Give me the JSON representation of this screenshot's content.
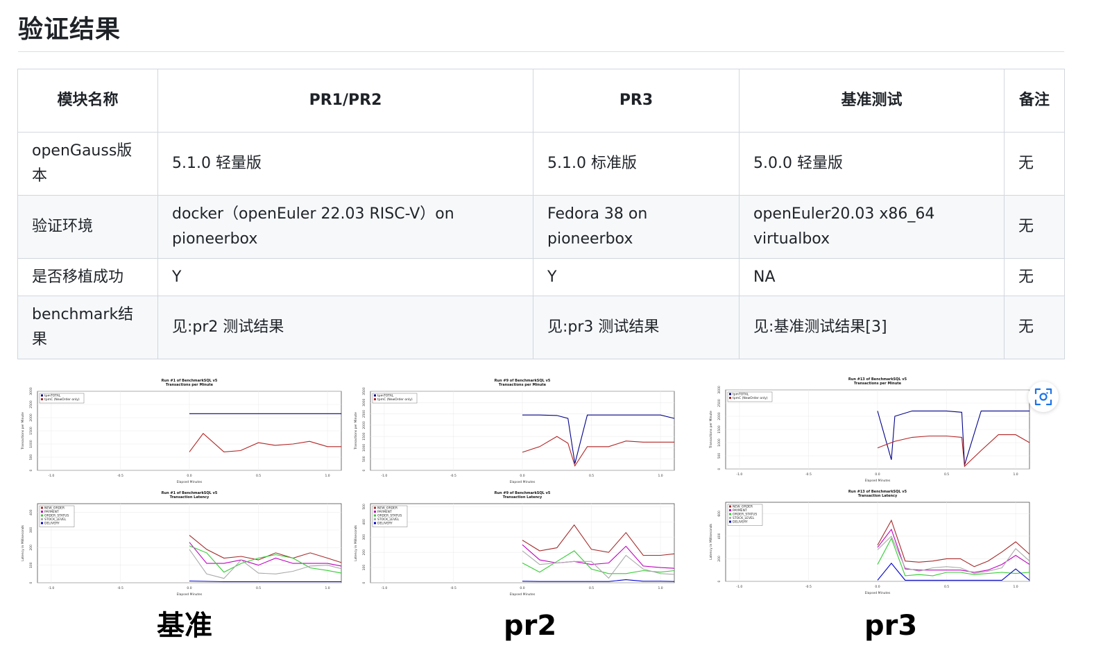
{
  "page": {
    "title": "验证结果"
  },
  "table": {
    "headers": [
      "模块名称",
      "PR1/PR2",
      "PR3",
      "基准测试",
      "备注"
    ],
    "rows": [
      [
        "openGauss版本",
        "5.1.0 轻量版",
        "5.1.0 标准版",
        "5.0.0 轻量版",
        "无"
      ],
      [
        "验证环境",
        "docker（openEuler 22.03 RISC-V）on pioneerbox",
        "Fedora 38 on pioneerbox",
        "openEuler20.03 x86_64 virtualbox",
        "无"
      ],
      [
        "是否移植成功",
        "Y",
        "Y",
        "NA",
        "无"
      ],
      [
        "benchmark结果",
        "见:pr2 测试结果",
        "见:pr3 测试结果",
        "见:基准测试结果[3]",
        "无"
      ]
    ]
  },
  "captions": [
    "基准",
    "pr2",
    "pr3"
  ],
  "icons": {
    "scan": "scan-image-icon"
  },
  "colors": {
    "tpmTOTAL": "#00008b",
    "tpmC": "#b22222",
    "new_order": "#a52a2a",
    "payment": "#c000c0",
    "order_status": "#32cd32",
    "stock_level": "#a9a9a9",
    "delivery": "#0000cd"
  },
  "chart_data": [
    {
      "type": "line",
      "title": "Run #1 of BenchmarkSQL v5",
      "subtitle": "Transactions per Minute",
      "xlabel": "Elapsed Minutes",
      "ylabel": "Transactions per Minute",
      "xlim": [
        -1.1,
        1.1
      ],
      "ylim": [
        0,
        3000
      ],
      "x_ticks": [
        "-1.0",
        "-0.5",
        "0.0",
        "0.5",
        "1.0"
      ],
      "y_ticks": [
        "0",
        "500",
        "1000",
        "1500",
        "2000",
        "2500",
        "3000"
      ],
      "legend": "top-left",
      "series": [
        {
          "name": "tpmTOTAL",
          "x": [
            0,
            0.125,
            0.25,
            0.375,
            0.5,
            0.625,
            0.75,
            0.875,
            1.0,
            1.1
          ],
          "y": [
            2150,
            2150,
            2150,
            2150,
            2150,
            2150,
            2150,
            2150,
            2150,
            2150
          ]
        },
        {
          "name": "tpmC (NewOrder only)",
          "x": [
            0,
            0.1,
            0.25,
            0.37,
            0.5,
            0.62,
            0.75,
            0.87,
            1.0,
            1.1
          ],
          "y": [
            700,
            1400,
            700,
            750,
            1050,
            950,
            1000,
            1100,
            900,
            900
          ]
        }
      ]
    },
    {
      "type": "line",
      "title": "Run #1 of BenchmarkSQL v5",
      "subtitle": "Transaction Latency",
      "xlabel": "Elapsed Minutes",
      "ylabel": "Latency in Milliseconds",
      "xlim": [
        -1.1,
        1.1
      ],
      "ylim": [
        0,
        450
      ],
      "x_ticks": [
        "-1.0",
        "-0.5",
        "0.0",
        "0.5",
        "1.0"
      ],
      "y_ticks": [
        "0",
        "100",
        "200",
        "300",
        "400"
      ],
      "legend": "top-left",
      "series": [
        {
          "name": "NEW_ORDER",
          "x": [
            0,
            0.125,
            0.25,
            0.375,
            0.5,
            0.625,
            0.75,
            0.875,
            1.0,
            1.1
          ],
          "y": [
            270,
            190,
            140,
            150,
            130,
            170,
            140,
            170,
            140,
            115
          ]
        },
        {
          "name": "PAYMENT",
          "x": [
            0,
            0.125,
            0.25,
            0.375,
            0.5,
            0.625,
            0.75,
            0.875,
            1.0,
            1.1
          ],
          "y": [
            230,
            110,
            110,
            130,
            100,
            140,
            110,
            110,
            110,
            95
          ]
        },
        {
          "name": "ORDER_STATUS",
          "x": [
            0,
            0.125,
            0.25,
            0.375,
            0.5,
            0.625,
            0.75,
            0.875,
            1.0,
            1.1
          ],
          "y": [
            210,
            170,
            60,
            110,
            140,
            160,
            140,
            85,
            70,
            55
          ]
        },
        {
          "name": "STOCK_LEVEL",
          "x": [
            0,
            0.125,
            0.25,
            0.375,
            0.5,
            0.625,
            0.75,
            0.875,
            1.0,
            1.1
          ],
          "y": [
            190,
            50,
            25,
            130,
            55,
            50,
            65,
            95,
            100,
            80
          ]
        },
        {
          "name": "DELIVERY",
          "x": [
            0,
            0.125,
            0.25,
            0.375,
            0.5,
            0.625,
            0.75,
            0.875,
            1.0,
            1.1
          ],
          "y": [
            10,
            8,
            6,
            6,
            6,
            6,
            6,
            6,
            6,
            6
          ]
        }
      ]
    },
    {
      "type": "line",
      "title": "Run #9 of BenchmarkSQL v5",
      "subtitle": "Transactions per Minute",
      "xlabel": "Elapsed Minutes",
      "ylabel": "Transactions per Minute",
      "xlim": [
        -1.1,
        1.1
      ],
      "ylim": [
        0,
        3500
      ],
      "x_ticks": [
        "-1.0",
        "-0.5",
        "0.0",
        "0.5",
        "1.0"
      ],
      "y_ticks": [
        "0",
        "500",
        "1000",
        "1500",
        "2000",
        "2500",
        "3000",
        "3500"
      ],
      "legend": "top-left",
      "series": [
        {
          "name": "tpmTOTAL",
          "x": [
            0,
            0.125,
            0.25,
            0.33,
            0.38,
            0.47,
            0.625,
            0.75,
            0.875,
            1.0,
            1.1
          ],
          "y": [
            2450,
            2450,
            2430,
            2300,
            300,
            2450,
            2450,
            2450,
            2450,
            2450,
            2300
          ]
        },
        {
          "name": "tpmC (NewOrder only)",
          "x": [
            0,
            0.125,
            0.25,
            0.33,
            0.38,
            0.47,
            0.625,
            0.75,
            0.875,
            1.0,
            1.1
          ],
          "y": [
            800,
            1050,
            1500,
            1200,
            200,
            1050,
            1050,
            1300,
            1250,
            1250,
            1250
          ]
        }
      ]
    },
    {
      "type": "line",
      "title": "Run #9 of BenchmarkSQL v5",
      "subtitle": "Transaction Latency",
      "xlabel": "Elapsed Minutes",
      "ylabel": "Latency in Milliseconds",
      "xlim": [
        -1.1,
        1.1
      ],
      "ylim": [
        0,
        520
      ],
      "x_ticks": [
        "-1.0",
        "-0.5",
        "0.0",
        "0.5",
        "1.0"
      ],
      "y_ticks": [
        "0",
        "100",
        "200",
        "300",
        "400",
        "500"
      ],
      "legend": "top-left",
      "series": [
        {
          "name": "NEW_ORDER",
          "x": [
            0,
            0.125,
            0.25,
            0.375,
            0.5,
            0.625,
            0.75,
            0.875,
            1.0,
            1.1
          ],
          "y": [
            280,
            210,
            230,
            380,
            220,
            200,
            330,
            180,
            180,
            190
          ]
        },
        {
          "name": "PAYMENT",
          "x": [
            0,
            0.125,
            0.25,
            0.375,
            0.5,
            0.625,
            0.75,
            0.875,
            1.0,
            1.1
          ],
          "y": [
            250,
            150,
            130,
            140,
            120,
            130,
            240,
            110,
            100,
            95
          ]
        },
        {
          "name": "ORDER_STATUS",
          "x": [
            0,
            0.125,
            0.25,
            0.375,
            0.5,
            0.625,
            0.75,
            0.875,
            1.0,
            1.1
          ],
          "y": [
            130,
            70,
            140,
            210,
            90,
            60,
            60,
            80,
            70,
            80
          ]
        },
        {
          "name": "STOCK_LEVEL",
          "x": [
            0,
            0.125,
            0.25,
            0.375,
            0.5,
            0.625,
            0.75,
            0.875,
            1.0,
            1.1
          ],
          "y": [
            210,
            120,
            130,
            140,
            140,
            30,
            180,
            90,
            60,
            55
          ]
        },
        {
          "name": "DELIVERY",
          "x": [
            0,
            0.125,
            0.25,
            0.375,
            0.5,
            0.625,
            0.75,
            0.875,
            1.0,
            1.1
          ],
          "y": [
            10,
            8,
            8,
            8,
            8,
            8,
            20,
            10,
            10,
            8
          ]
        }
      ]
    },
    {
      "type": "line",
      "title": "Run #13 of BenchmarkSQL v5",
      "subtitle": "Transactions per Minute",
      "xlabel": "Elapsed Minutes",
      "ylabel": "Transactions per Minute",
      "xlim": [
        -1.1,
        1.1
      ],
      "ylim": [
        0,
        3000
      ],
      "x_ticks": [
        "-1.0",
        "-0.5",
        "0.0",
        "0.5",
        "1.0"
      ],
      "y_ticks": [
        "0",
        "500",
        "1000",
        "1500",
        "2000",
        "2500",
        "3000"
      ],
      "legend": "top-left",
      "series": [
        {
          "name": "tpmTOTAL",
          "x": [
            0,
            0.1,
            0.125,
            0.25,
            0.375,
            0.5,
            0.61,
            0.63,
            0.75,
            0.875,
            1.0,
            1.1
          ],
          "y": [
            2200,
            350,
            2000,
            2200,
            2200,
            2200,
            2150,
            150,
            2200,
            2200,
            2200,
            2200
          ]
        },
        {
          "name": "tpmC (NewOrder only)",
          "x": [
            0,
            0.1,
            0.125,
            0.25,
            0.375,
            0.5,
            0.61,
            0.63,
            0.75,
            0.875,
            1.0,
            1.1
          ],
          "y": [
            800,
            1000,
            1050,
            1200,
            1250,
            1250,
            1200,
            100,
            700,
            1300,
            1300,
            1000
          ]
        }
      ]
    },
    {
      "type": "line",
      "title": "Run #13 of BenchmarkSQL v5",
      "subtitle": "Transaction Latency",
      "xlabel": "Elapsed Minutes",
      "ylabel": "Latency in Milliseconds",
      "xlim": [
        -1.1,
        1.1
      ],
      "ylim": [
        0,
        700
      ],
      "x_ticks": [
        "-1.0",
        "-0.5",
        "0.0",
        "0.5",
        "1.0"
      ],
      "y_ticks": [
        "0",
        "200",
        "400",
        "600"
      ],
      "legend": "top-left",
      "series": [
        {
          "name": "NEW_ORDER",
          "x": [
            0,
            0.1,
            0.2,
            0.3,
            0.4,
            0.5,
            0.6,
            0.7,
            0.8,
            0.9,
            1.0,
            1.1
          ],
          "y": [
            320,
            540,
            180,
            170,
            180,
            200,
            200,
            130,
            180,
            260,
            350,
            240
          ]
        },
        {
          "name": "PAYMENT",
          "x": [
            0,
            0.1,
            0.2,
            0.3,
            0.4,
            0.5,
            0.6,
            0.7,
            0.8,
            0.9,
            1.0,
            1.1
          ],
          "y": [
            300,
            460,
            110,
            100,
            100,
            100,
            100,
            80,
            100,
            150,
            230,
            150
          ]
        },
        {
          "name": "ORDER_STATUS",
          "x": [
            0,
            0.1,
            0.2,
            0.3,
            0.4,
            0.5,
            0.6,
            0.7,
            0.8,
            0.9,
            1.0,
            1.1
          ],
          "y": [
            150,
            380,
            50,
            60,
            50,
            80,
            80,
            60,
            70,
            80,
            70,
            80
          ]
        },
        {
          "name": "STOCK_LEVEL",
          "x": [
            0,
            0.1,
            0.2,
            0.3,
            0.4,
            0.5,
            0.6,
            0.7,
            0.8,
            0.9,
            1.0,
            1.1
          ],
          "y": [
            280,
            400,
            120,
            90,
            120,
            130,
            120,
            70,
            90,
            120,
            290,
            180
          ]
        },
        {
          "name": "DELIVERY",
          "x": [
            0,
            0.1,
            0.2,
            0.3,
            0.4,
            0.5,
            0.6,
            0.7,
            0.8,
            0.9,
            1.0,
            1.1
          ],
          "y": [
            10,
            160,
            10,
            10,
            10,
            10,
            10,
            10,
            10,
            10,
            110,
            10
          ]
        }
      ]
    }
  ]
}
